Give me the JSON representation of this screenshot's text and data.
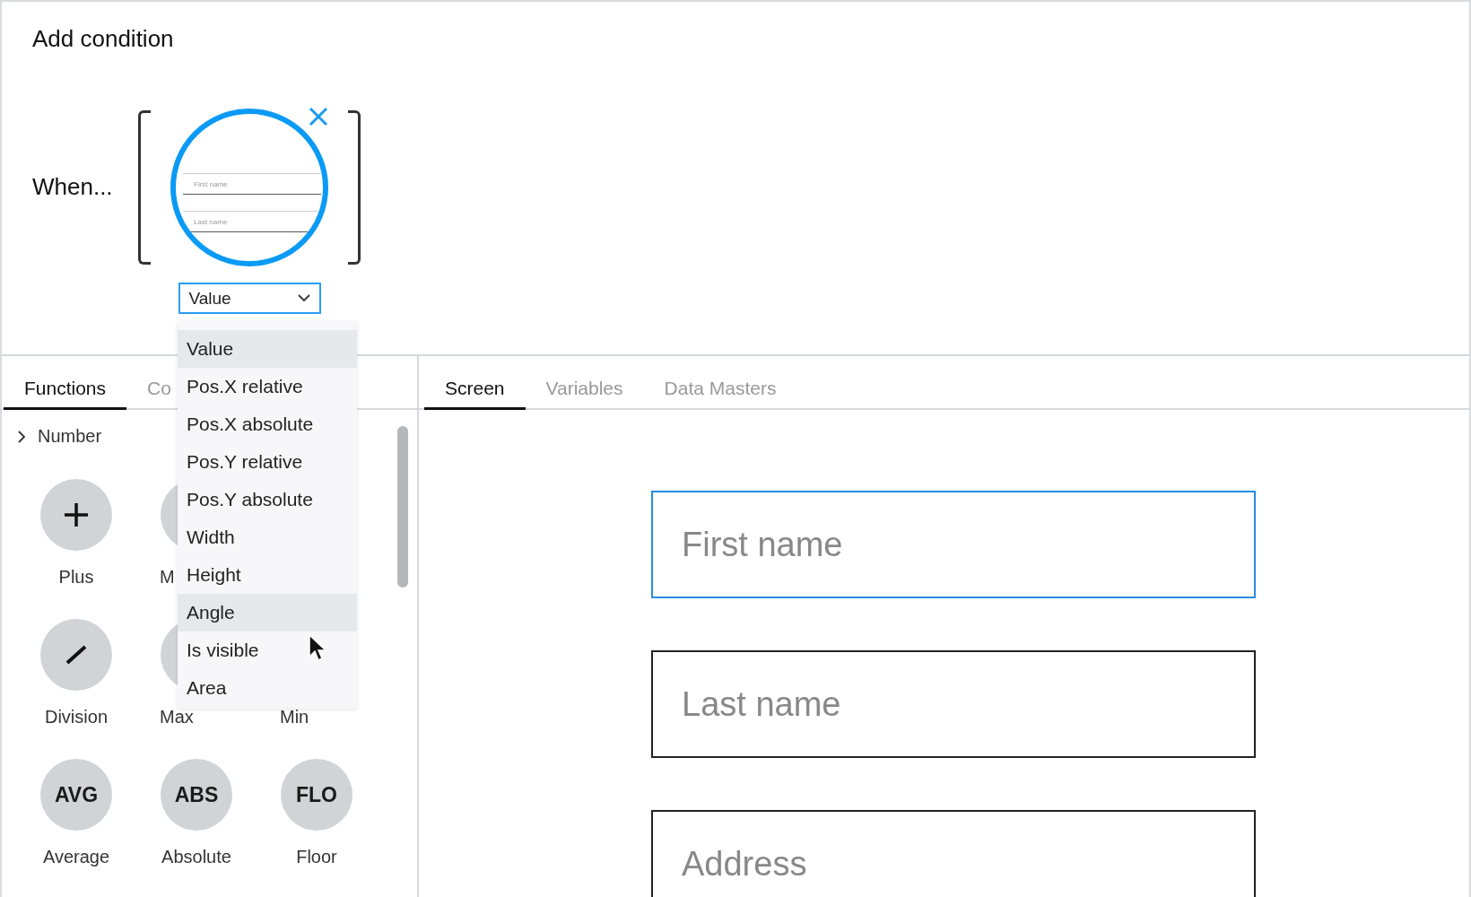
{
  "title": "Add condition",
  "condition": {
    "label": "When...",
    "preview_fields": [
      {
        "placeholder": "First name"
      },
      {
        "placeholder": "Last name"
      }
    ],
    "property": {
      "value": "Value"
    }
  },
  "property_menu": {
    "items": [
      {
        "label": "Value",
        "highlighted": true
      },
      {
        "label": "Pos.X relative",
        "highlighted": false
      },
      {
        "label": "Pos.X absolute",
        "highlighted": false
      },
      {
        "label": "Pos.Y relative",
        "highlighted": false
      },
      {
        "label": "Pos.Y absolute",
        "highlighted": false
      },
      {
        "label": "Width",
        "highlighted": false
      },
      {
        "label": "Height",
        "highlighted": false
      },
      {
        "label": "Angle",
        "highlighted": true
      },
      {
        "label": "Is visible",
        "highlighted": false
      },
      {
        "label": "Area",
        "highlighted": false
      }
    ]
  },
  "functions_panel": {
    "tabs": [
      {
        "label": "Functions",
        "selected": true
      },
      {
        "label": "Co",
        "selected": false
      }
    ],
    "category": {
      "label": "Number",
      "expanded": false
    },
    "rows": [
      [
        {
          "kind": "plus",
          "label": "Plus"
        },
        {
          "kind": "covered",
          "label": "M"
        }
      ],
      [
        {
          "kind": "division",
          "label": "Division"
        },
        {
          "kind": "covered",
          "label": "Max"
        },
        {
          "kind": "hidden",
          "label": "Min"
        }
      ],
      [
        {
          "kind": "text",
          "symbol": "AVG",
          "label": "Average"
        },
        {
          "kind": "text",
          "symbol": "ABS",
          "label": "Absolute"
        },
        {
          "kind": "text",
          "symbol": "FLO",
          "label": "Floor"
        }
      ]
    ]
  },
  "screen_panel": {
    "tabs": [
      {
        "label": "Screen",
        "selected": true
      },
      {
        "label": "Variables",
        "selected": false
      },
      {
        "label": "Data Masters",
        "selected": false
      }
    ],
    "fields": [
      {
        "placeholder": "First name",
        "selected": true
      },
      {
        "placeholder": "Last name",
        "selected": false
      },
      {
        "placeholder": "Address",
        "selected": false
      }
    ]
  }
}
